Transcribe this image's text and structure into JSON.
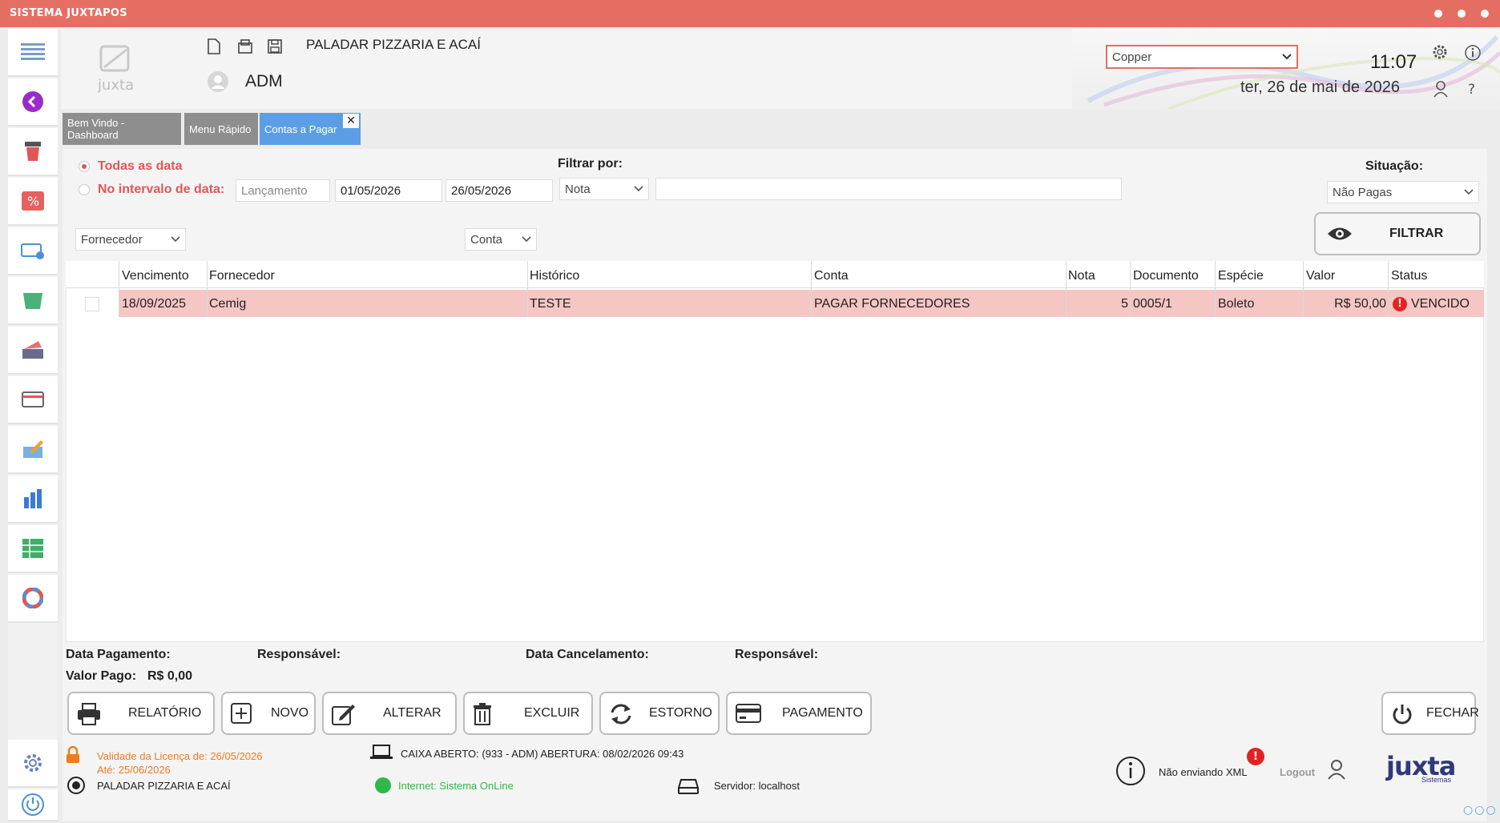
{
  "window": {
    "title": "SISTEMA JUXTAPOS"
  },
  "header": {
    "company": "PALADAR PIZZARIA E ACAÍ",
    "user": "ADM",
    "logo_text": "juxta",
    "theme_select": "Copper",
    "time": "11:07",
    "date": "ter, 26 de mai de 2026"
  },
  "tabs": [
    {
      "label": "Bem Vindo - Dashboard"
    },
    {
      "label": "Menu Rápido"
    },
    {
      "label": "Contas a Pagar"
    }
  ],
  "filters": {
    "radio_all": "Todas as data",
    "radio_interval": "No intervalo de data:",
    "date_type": "Lançamento",
    "date_from": "01/05/2026",
    "date_to": "26/05/2026",
    "filter_by_label": "Filtrar por:",
    "filter_by_value": "Nota",
    "filter_text": "",
    "situacao_label": "Situação:",
    "situacao_value": "Não Pagas",
    "fornecedor": "Fornecedor",
    "conta": "Conta",
    "filter_button": "FILTRAR"
  },
  "table": {
    "columns": [
      "Vencimento",
      "Fornecedor",
      "Histórico",
      "Conta",
      "Nota",
      "Documento",
      "Espécie",
      "Valor",
      "Status"
    ],
    "rows": [
      {
        "vencimento": "18/09/2025",
        "fornecedor": "Cemig",
        "historico": "TESTE",
        "conta": "PAGAR FORNECEDORES",
        "nota": "5",
        "documento": "0005/1",
        "especie": "Boleto",
        "valor": "R$ 50,00",
        "status": "VENCIDO"
      }
    ]
  },
  "details": {
    "data_pagamento": "Data Pagamento:",
    "responsavel1": "Responsável:",
    "data_cancelamento": "Data Cancelamento:",
    "responsavel2": "Responsável:",
    "valor_pago_label": "Valor Pago:",
    "valor_pago": "R$ 0,00"
  },
  "actions": {
    "relatorio": "RELATÓRIO",
    "novo": "NOVO",
    "alterar": "ALTERAR",
    "excluir": "EXCLUIR",
    "estorno": "ESTORNO",
    "pagamento": "PAGAMENTO",
    "fechar": "FECHAR"
  },
  "footer": {
    "licenca": "Validade da Licença de: 26/05/2026",
    "ate": "Até: 25/06/2026",
    "empresa": "PALADAR PIZZARIA E ACAÍ",
    "caixa": "CAIXA ABERTO: (933 - ADM) ABERTURA: 08/02/2026 09:43",
    "internet": "Internet: Sistema OnLine",
    "servidor": "Servidor: localhost",
    "xml": "Não enviando XML",
    "logout": "Logout",
    "brand": "juxta",
    "brand_sub": "Sistemas"
  },
  "colors": {
    "titlebar": "#e56e63",
    "row_highlight": "#f4c6c4",
    "tab_active": "#5b9ee6",
    "tab_inactive": "#9a9a9a",
    "alert": "#e02424",
    "online": "#2fb84a",
    "license": "#f07b1e"
  }
}
